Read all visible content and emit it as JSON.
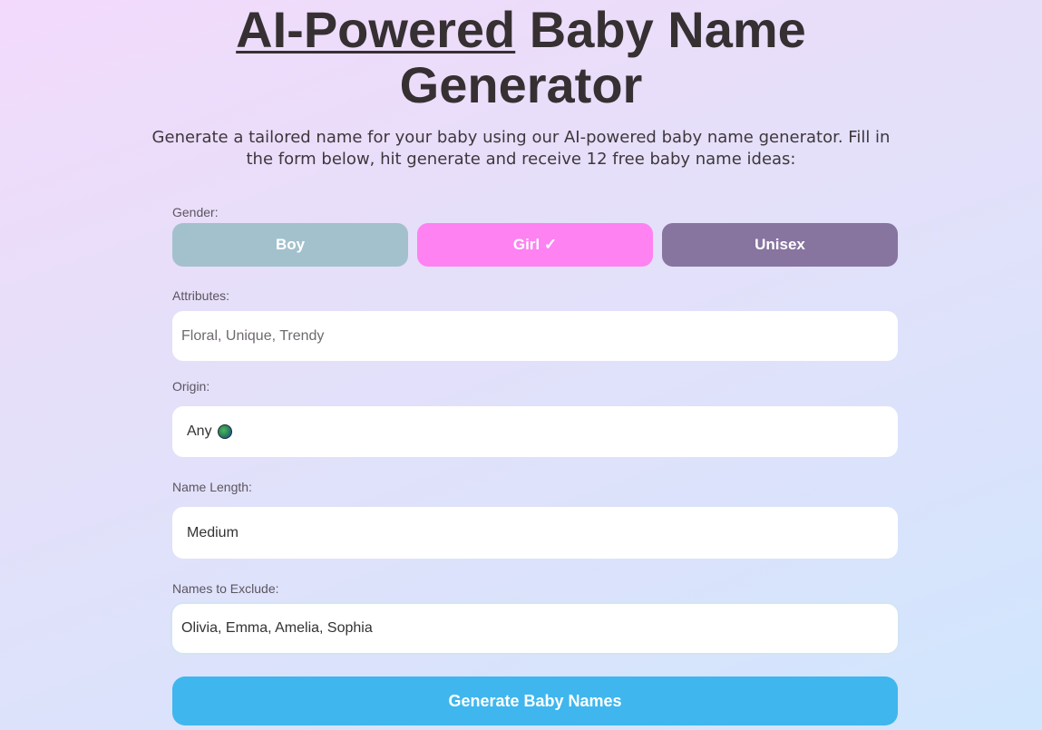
{
  "header": {
    "title_underlined": "AI-Powered",
    "title_rest_line1": " Baby Name",
    "title_line2": "Generator",
    "subtitle": "Generate a tailored name for your baby using our AI-powered baby name generator. Fill in the form below, hit generate and receive 12 free baby name ideas:"
  },
  "form": {
    "gender": {
      "label": "Gender:",
      "options": [
        {
          "label": "Boy",
          "color": "#a3c1cd",
          "selected": false
        },
        {
          "label": "Girl ✓",
          "color": "#fe82f2",
          "selected": true
        },
        {
          "label": "Unisex",
          "color": "#87749f",
          "selected": false
        }
      ]
    },
    "attributes": {
      "label": "Attributes:",
      "placeholder": "Floral, Unique, Trendy",
      "value": ""
    },
    "origin": {
      "label": "Origin:",
      "value": "Any",
      "icon": "globe-icon"
    },
    "name_length": {
      "label": "Name Length:",
      "value": "Medium"
    },
    "exclude": {
      "label": "Names to Exclude:",
      "value": "Olivia, Emma, Amelia, Sophia"
    },
    "submit_label": "Generate Baby Names",
    "submit_color": "#3fb6ee"
  }
}
